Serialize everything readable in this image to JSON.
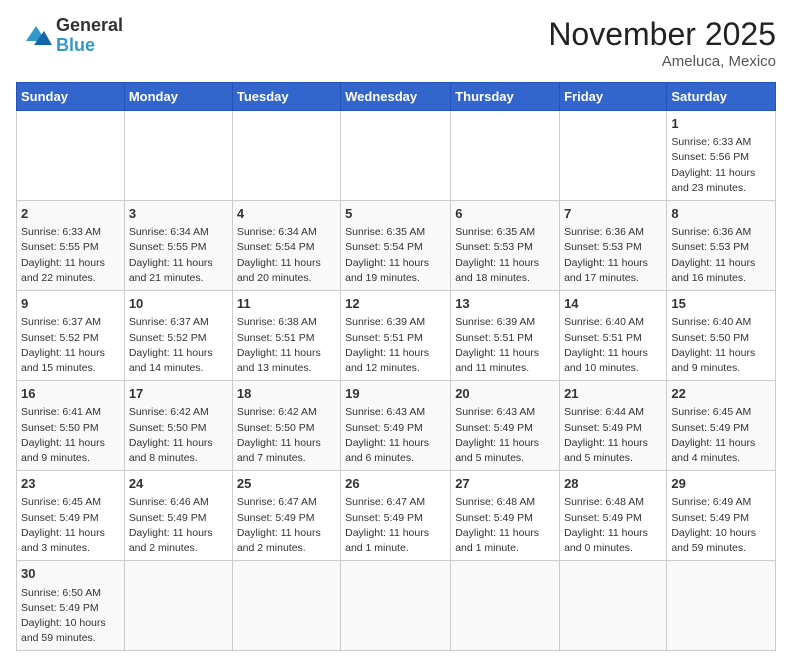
{
  "header": {
    "logo_general": "General",
    "logo_blue": "Blue",
    "title": "November 2025",
    "subtitle": "Ameluca, Mexico"
  },
  "weekdays": [
    "Sunday",
    "Monday",
    "Tuesday",
    "Wednesday",
    "Thursday",
    "Friday",
    "Saturday"
  ],
  "weeks": [
    [
      {
        "day": "",
        "info": ""
      },
      {
        "day": "",
        "info": ""
      },
      {
        "day": "",
        "info": ""
      },
      {
        "day": "",
        "info": ""
      },
      {
        "day": "",
        "info": ""
      },
      {
        "day": "",
        "info": ""
      },
      {
        "day": "1",
        "info": "Sunrise: 6:33 AM\nSunset: 5:56 PM\nDaylight: 11 hours and 23 minutes."
      }
    ],
    [
      {
        "day": "2",
        "info": "Sunrise: 6:33 AM\nSunset: 5:55 PM\nDaylight: 11 hours and 22 minutes."
      },
      {
        "day": "3",
        "info": "Sunrise: 6:34 AM\nSunset: 5:55 PM\nDaylight: 11 hours and 21 minutes."
      },
      {
        "day": "4",
        "info": "Sunrise: 6:34 AM\nSunset: 5:54 PM\nDaylight: 11 hours and 20 minutes."
      },
      {
        "day": "5",
        "info": "Sunrise: 6:35 AM\nSunset: 5:54 PM\nDaylight: 11 hours and 19 minutes."
      },
      {
        "day": "6",
        "info": "Sunrise: 6:35 AM\nSunset: 5:53 PM\nDaylight: 11 hours and 18 minutes."
      },
      {
        "day": "7",
        "info": "Sunrise: 6:36 AM\nSunset: 5:53 PM\nDaylight: 11 hours and 17 minutes."
      },
      {
        "day": "8",
        "info": "Sunrise: 6:36 AM\nSunset: 5:53 PM\nDaylight: 11 hours and 16 minutes."
      }
    ],
    [
      {
        "day": "9",
        "info": "Sunrise: 6:37 AM\nSunset: 5:52 PM\nDaylight: 11 hours and 15 minutes."
      },
      {
        "day": "10",
        "info": "Sunrise: 6:37 AM\nSunset: 5:52 PM\nDaylight: 11 hours and 14 minutes."
      },
      {
        "day": "11",
        "info": "Sunrise: 6:38 AM\nSunset: 5:51 PM\nDaylight: 11 hours and 13 minutes."
      },
      {
        "day": "12",
        "info": "Sunrise: 6:39 AM\nSunset: 5:51 PM\nDaylight: 11 hours and 12 minutes."
      },
      {
        "day": "13",
        "info": "Sunrise: 6:39 AM\nSunset: 5:51 PM\nDaylight: 11 hours and 11 minutes."
      },
      {
        "day": "14",
        "info": "Sunrise: 6:40 AM\nSunset: 5:51 PM\nDaylight: 11 hours and 10 minutes."
      },
      {
        "day": "15",
        "info": "Sunrise: 6:40 AM\nSunset: 5:50 PM\nDaylight: 11 hours and 9 minutes."
      }
    ],
    [
      {
        "day": "16",
        "info": "Sunrise: 6:41 AM\nSunset: 5:50 PM\nDaylight: 11 hours and 9 minutes."
      },
      {
        "day": "17",
        "info": "Sunrise: 6:42 AM\nSunset: 5:50 PM\nDaylight: 11 hours and 8 minutes."
      },
      {
        "day": "18",
        "info": "Sunrise: 6:42 AM\nSunset: 5:50 PM\nDaylight: 11 hours and 7 minutes."
      },
      {
        "day": "19",
        "info": "Sunrise: 6:43 AM\nSunset: 5:49 PM\nDaylight: 11 hours and 6 minutes."
      },
      {
        "day": "20",
        "info": "Sunrise: 6:43 AM\nSunset: 5:49 PM\nDaylight: 11 hours and 5 minutes."
      },
      {
        "day": "21",
        "info": "Sunrise: 6:44 AM\nSunset: 5:49 PM\nDaylight: 11 hours and 5 minutes."
      },
      {
        "day": "22",
        "info": "Sunrise: 6:45 AM\nSunset: 5:49 PM\nDaylight: 11 hours and 4 minutes."
      }
    ],
    [
      {
        "day": "23",
        "info": "Sunrise: 6:45 AM\nSunset: 5:49 PM\nDaylight: 11 hours and 3 minutes."
      },
      {
        "day": "24",
        "info": "Sunrise: 6:46 AM\nSunset: 5:49 PM\nDaylight: 11 hours and 2 minutes."
      },
      {
        "day": "25",
        "info": "Sunrise: 6:47 AM\nSunset: 5:49 PM\nDaylight: 11 hours and 2 minutes."
      },
      {
        "day": "26",
        "info": "Sunrise: 6:47 AM\nSunset: 5:49 PM\nDaylight: 11 hours and 1 minute."
      },
      {
        "day": "27",
        "info": "Sunrise: 6:48 AM\nSunset: 5:49 PM\nDaylight: 11 hours and 1 minute."
      },
      {
        "day": "28",
        "info": "Sunrise: 6:48 AM\nSunset: 5:49 PM\nDaylight: 11 hours and 0 minutes."
      },
      {
        "day": "29",
        "info": "Sunrise: 6:49 AM\nSunset: 5:49 PM\nDaylight: 10 hours and 59 minutes."
      }
    ],
    [
      {
        "day": "30",
        "info": "Sunrise: 6:50 AM\nSunset: 5:49 PM\nDaylight: 10 hours and 59 minutes."
      },
      {
        "day": "",
        "info": ""
      },
      {
        "day": "",
        "info": ""
      },
      {
        "day": "",
        "info": ""
      },
      {
        "day": "",
        "info": ""
      },
      {
        "day": "",
        "info": ""
      },
      {
        "day": "",
        "info": ""
      }
    ]
  ]
}
